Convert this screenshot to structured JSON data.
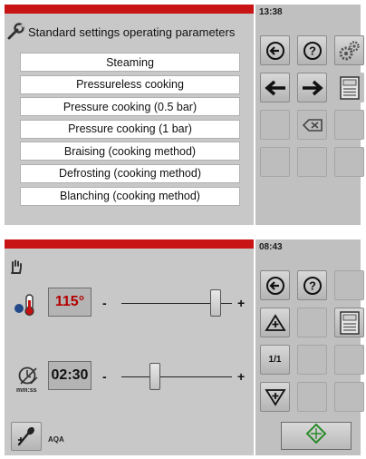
{
  "screen1": {
    "time": "13:38",
    "title": "Standard settings operating parameters",
    "menu_items": [
      "Steaming",
      "Pressureless cooking",
      "Pressure cooking (0.5 bar)",
      "Pressure cooking (1 bar)",
      "Braising (cooking method)",
      "Defrosting (cooking method)",
      "Blanching (cooking method)"
    ],
    "icons": {
      "title": "wrench-icon",
      "back": "back-arrow-icon",
      "help": "help-icon",
      "settings": "gears-icon",
      "left": "arrow-left-icon",
      "right": "arrow-right-icon",
      "save": "save-icon",
      "delete": "backspace-icon"
    }
  },
  "screen2": {
    "time": "08:43",
    "temperature": {
      "value": "115°",
      "minus": "-",
      "plus": "+",
      "slider_fraction": 0.85,
      "value_color": "#b30000"
    },
    "duration": {
      "value": "02:30",
      "unit": "mm:ss",
      "minus": "-",
      "plus": "+",
      "slider_fraction": 0.3
    },
    "probe_label": "AQA",
    "portion_label": "1/1",
    "icons": {
      "hand": "hand-icon",
      "thermometer": "thermometer-icon",
      "timer": "timer-icon",
      "probe": "probe-add-icon",
      "back": "back-arrow-icon",
      "help": "help-icon",
      "up": "increase-icon",
      "down": "decrease-icon",
      "save": "save-icon",
      "start": "start-icon"
    },
    "accent_color": "#2a8a2a"
  },
  "colors": {
    "red_bar": "#c81414",
    "panel_bg": "#c8c8c8",
    "button_panel_bg": "#c0c0c0"
  }
}
